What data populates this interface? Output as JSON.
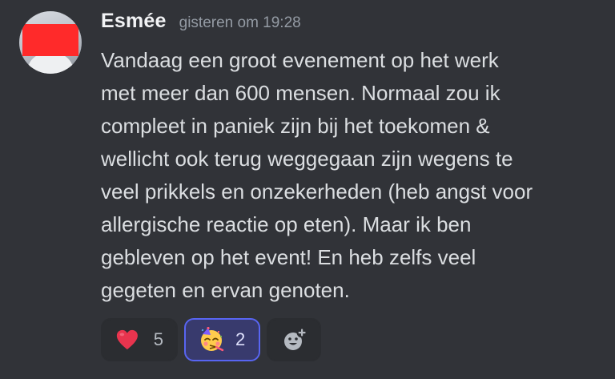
{
  "message": {
    "author": "Esmée",
    "timestamp": "gisteren om 19:28",
    "lines": [
      "Vandaag een groot evenement op het werk",
      "met meer dan 600 mensen. Normaal zou ik",
      "compleet in paniek zijn bij het toekomen &",
      "wellicht ook terug weggegaan zijn wegens te",
      "veel prikkels en onzekerheden (heb angst voor",
      "allergische reactie op eten). Maar ik ben",
      "gebleven op het event! En heb zelfs veel",
      "gegeten en ervan genoten."
    ]
  },
  "reactions": [
    {
      "emoji": "red-heart",
      "count": "5",
      "selected": false
    },
    {
      "emoji": "partying-face",
      "count": "2",
      "selected": true
    }
  ],
  "add_reaction": {
    "icon": "add-reaction-icon"
  },
  "colors": {
    "background": "#313338",
    "reaction_bg": "#2b2d31",
    "selected_bg": "#383a6d",
    "selected_border": "#5865f2",
    "heart": "#e8344e"
  }
}
